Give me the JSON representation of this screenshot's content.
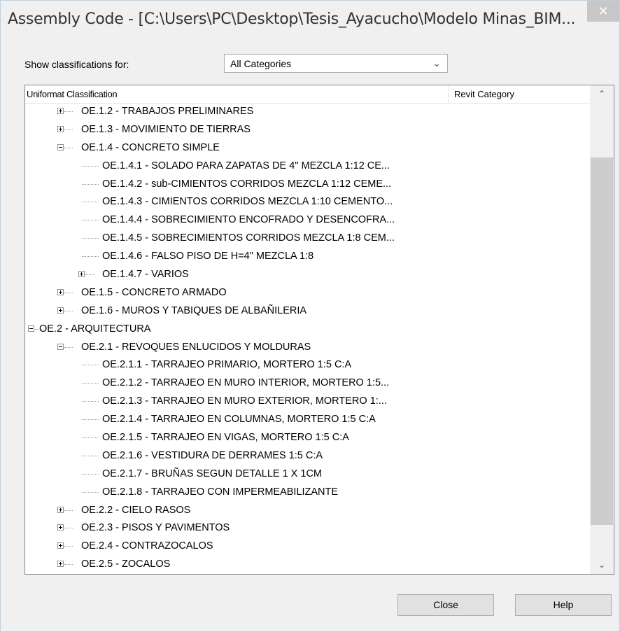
{
  "window": {
    "title": "Assembly Code - [C:\\Users\\PC\\Desktop\\Tesis_Ayacucho\\Modelo Minas_BIM...",
    "close_glyph": "✕"
  },
  "filter": {
    "label": "Show classifications for:",
    "selected": "All Categories",
    "arrow": "⌄"
  },
  "tree": {
    "col_classification": "Uniformat Classification",
    "col_category": "Revit Category",
    "scroll_up": "⌃",
    "scroll_down": "⌄",
    "scroll_position": {
      "start": 0.12,
      "end": 0.93
    },
    "rows": [
      {
        "level": 1,
        "expander": "plus",
        "label": "OE.1.2 - TRABAJOS PRELIMINARES"
      },
      {
        "level": 1,
        "expander": "plus",
        "label": "OE.1.3 - MOVIMIENTO DE TIERRAS"
      },
      {
        "level": 1,
        "expander": "minus",
        "label": "OE.1.4 - CONCRETO SIMPLE"
      },
      {
        "level": 2,
        "expander": "none",
        "label": "OE.1.4.1 - SOLADO PARA ZAPATAS DE 4\" MEZCLA 1:12 CE..."
      },
      {
        "level": 2,
        "expander": "none",
        "label": "OE.1.4.2 - sub-CIMIENTOS CORRIDOS MEZCLA 1:12 CEME..."
      },
      {
        "level": 2,
        "expander": "none",
        "label": "OE.1.4.3 - CIMIENTOS CORRIDOS MEZCLA 1:10 CEMENTO..."
      },
      {
        "level": 2,
        "expander": "none",
        "label": "OE.1.4.4 - SOBRECIMIENTO ENCOFRADO Y DESENCOFRA..."
      },
      {
        "level": 2,
        "expander": "none",
        "label": "OE.1.4.5 - SOBRECIMIENTOS CORRIDOS MEZCLA 1:8 CEM..."
      },
      {
        "level": 2,
        "expander": "none",
        "label": "OE.1.4.6 - FALSO PISO DE H=4\" MEZCLA 1:8"
      },
      {
        "level": 2,
        "expander": "plus",
        "label": "OE.1.4.7 - VARIOS"
      },
      {
        "level": 1,
        "expander": "plus",
        "label": "OE.1.5 - CONCRETO ARMADO"
      },
      {
        "level": 1,
        "expander": "plus",
        "label": "OE.1.6 - MUROS Y TABIQUES DE ALBAÑILERIA"
      },
      {
        "level": 0,
        "expander": "minus",
        "label": "OE.2 - ARQUITECTURA"
      },
      {
        "level": 1,
        "expander": "minus",
        "label": "OE.2.1 - REVOQUES ENLUCIDOS Y MOLDURAS"
      },
      {
        "level": 2,
        "expander": "none",
        "label": "OE.2.1.1 - TARRAJEO PRIMARIO, MORTERO 1:5 C:A"
      },
      {
        "level": 2,
        "expander": "none",
        "label": "OE.2.1.2 - TARRAJEO EN MURO INTERIOR, MORTERO 1:5..."
      },
      {
        "level": 2,
        "expander": "none",
        "label": "OE.2.1.3 - TARRAJEO EN MURO EXTERIOR, MORTERO 1:..."
      },
      {
        "level": 2,
        "expander": "none",
        "label": "OE.2.1.4 - TARRAJEO EN COLUMNAS, MORTERO 1:5 C:A"
      },
      {
        "level": 2,
        "expander": "none",
        "label": "OE.2.1.5 - TARRAJEO EN VIGAS, MORTERO 1:5 C:A"
      },
      {
        "level": 2,
        "expander": "none",
        "label": "OE.2.1.6 - VESTIDURA DE DERRAMES 1:5 C:A"
      },
      {
        "level": 2,
        "expander": "none",
        "label": "OE.2.1.7 - BRUÑAS SEGUN DETALLE 1 X 1CM"
      },
      {
        "level": 2,
        "expander": "none",
        "label": "OE.2.1.8 - TARRAJEO CON IMPERMEABILIZANTE"
      },
      {
        "level": 1,
        "expander": "plus",
        "label": "OE.2.2 - CIELO RASOS"
      },
      {
        "level": 1,
        "expander": "plus",
        "label": "OE.2.3 - PISOS Y PAVIMENTOS"
      },
      {
        "level": 1,
        "expander": "plus",
        "label": "OE.2.4 - CONTRAZOCALOS"
      },
      {
        "level": 1,
        "expander": "plus",
        "label": "OE.2.5 - ZOCALOS"
      }
    ]
  },
  "buttons": {
    "close": "Close",
    "help": "Help"
  }
}
